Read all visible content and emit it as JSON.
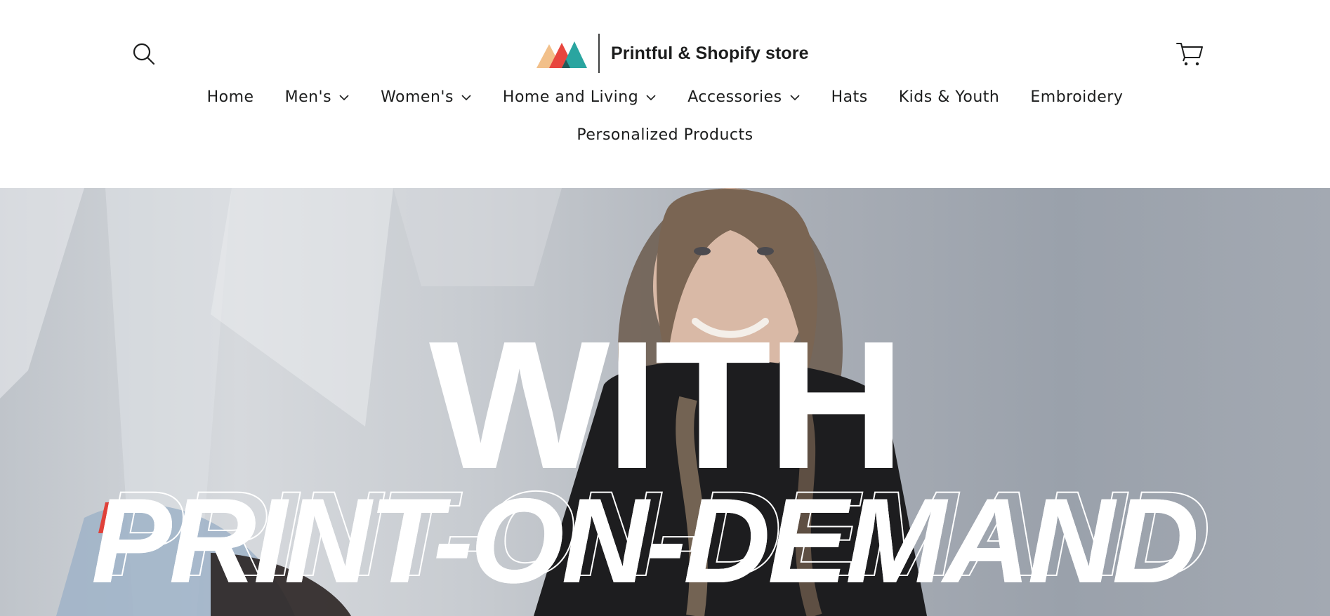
{
  "header": {
    "logo_text": "Printful & Shopify store",
    "logo_colors": [
      "#f2b880",
      "#e8463e",
      "#2aa5a0"
    ]
  },
  "nav": {
    "items": [
      {
        "label": "Home",
        "has_dropdown": false
      },
      {
        "label": "Men's",
        "has_dropdown": true
      },
      {
        "label": "Women's",
        "has_dropdown": true
      },
      {
        "label": "Home and Living",
        "has_dropdown": true
      },
      {
        "label": "Accessories",
        "has_dropdown": true
      },
      {
        "label": "Hats",
        "has_dropdown": false
      },
      {
        "label": "Kids & Youth",
        "has_dropdown": false
      },
      {
        "label": "Embroidery",
        "has_dropdown": false
      }
    ],
    "row2": [
      {
        "label": "Personalized Products",
        "has_dropdown": false
      }
    ]
  },
  "hero": {
    "line1": "WITH",
    "line2": "PRINT-ON-DEMAND"
  },
  "icons": {
    "search": "search-icon",
    "cart": "cart-icon",
    "chevron": "chevron-down-icon"
  }
}
